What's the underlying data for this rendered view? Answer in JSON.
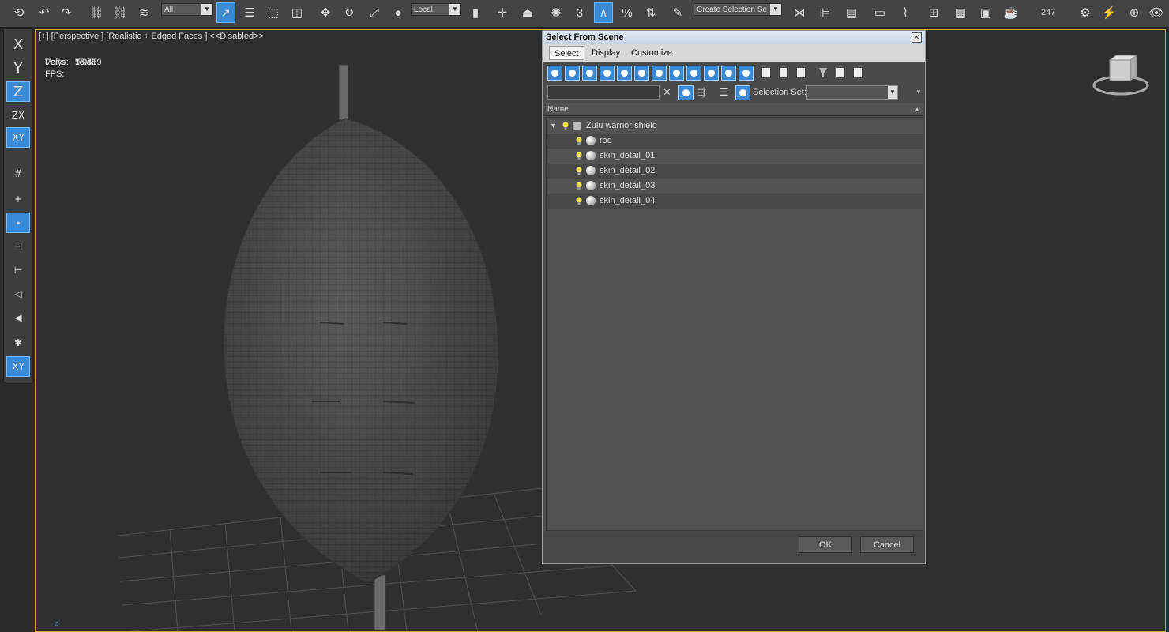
{
  "toolbar": {
    "selection_filter": "All",
    "coordinate_system": "Local",
    "named_selection": "Create Selection Se",
    "counter": "247",
    "icons": [
      "link-icon",
      "unlink-icon",
      "bind-space-warp-icon",
      "select-object-icon",
      "select-by-name-icon",
      "rectangle-selection-icon",
      "window-crossing-icon",
      "move-icon",
      "rotate-icon",
      "scale-icon",
      "pivot-icon",
      "select-manipulate-icon",
      "keyboard-shortcut-icon",
      "snap-toggle-icon",
      "angle-snap-icon",
      "percent-snap-icon",
      "spinner-snap-icon",
      "edit-named-selection-icon",
      "mirror-icon",
      "align-icon",
      "toggle-layer-icon",
      "toggle-ribbon-icon",
      "curve-editor-icon",
      "schematic-view-icon",
      "material-editor-icon",
      "render-setup-icon",
      "rendered-frame-icon",
      "render-icon"
    ]
  },
  "leftbar": {
    "items": [
      "X",
      "Y",
      "Z",
      "ZX",
      "XY"
    ]
  },
  "viewport": {
    "label": "[+] [Perspective ] [Realistic + Edged Faces ]  <<Disabled>>",
    "stats": {
      "header": "Total",
      "polys_label": "Polys:",
      "polys_value": "16 559",
      "verts_label": "Verts:",
      "verts_value": "9 041",
      "fps_label": "FPS:"
    },
    "axis_label": "z"
  },
  "dialog": {
    "title": "Select From Scene",
    "tabs": [
      "Select",
      "Display",
      "Customize"
    ],
    "active_tab": "Select",
    "selection_set_label": "Selection Set:",
    "column_header": "Name",
    "tree": [
      {
        "name": "Zulu warrior shield",
        "level": 0
      },
      {
        "name": "rod",
        "level": 1
      },
      {
        "name": "skin_detail_01",
        "level": 1
      },
      {
        "name": "skin_detail_02",
        "level": 1
      },
      {
        "name": "skin_detail_03",
        "level": 1
      },
      {
        "name": "skin_detail_04",
        "level": 1
      }
    ],
    "ok_label": "OK",
    "cancel_label": "Cancel"
  }
}
